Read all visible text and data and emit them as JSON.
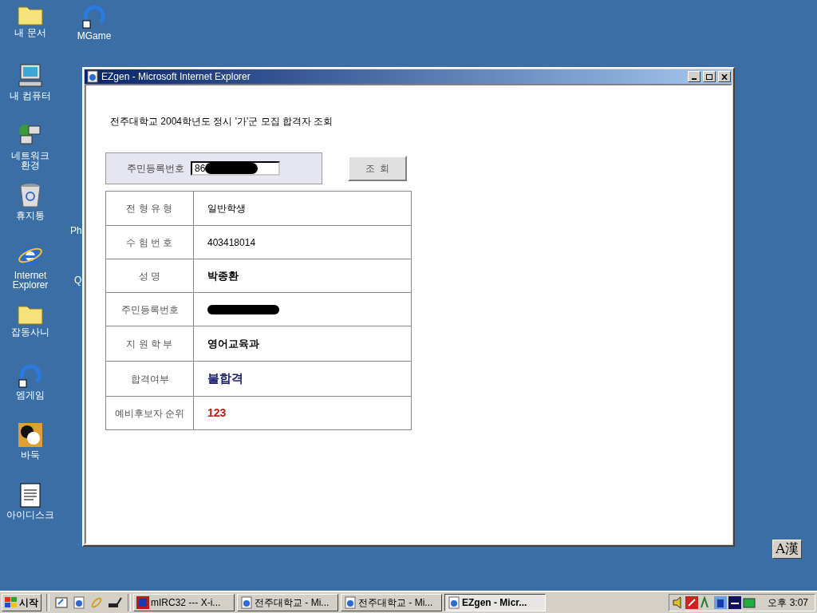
{
  "desktop_icons": [
    {
      "label": "내 문서",
      "kind": "folder-docs"
    },
    {
      "label": "내 컴퓨터",
      "kind": "computer"
    },
    {
      "label": "네트워크 환경",
      "kind": "network"
    },
    {
      "label": "휴지통",
      "kind": "bin"
    },
    {
      "label": "Internet Explorer",
      "kind": "ie"
    },
    {
      "label": "잡동사니",
      "kind": "folder"
    },
    {
      "label": "엠게임",
      "kind": "mgame"
    },
    {
      "label": "바둑",
      "kind": "go"
    },
    {
      "label": "아이디스크",
      "kind": "doc"
    }
  ],
  "desktop_icons_2": [
    {
      "label": "MGame",
      "kind": "mgame"
    },
    {
      "label": "Ph",
      "kind": "none"
    },
    {
      "label": "Q",
      "kind": "none"
    }
  ],
  "window": {
    "title": "EZgen - Microsoft Internet Explorer",
    "heading": "전주대학교 2004학년도 정시 '가'군 모집 합격자 조회",
    "search": {
      "label": "주민등록번호",
      "value": "86",
      "redacted": true
    },
    "button": "조  회",
    "rows": [
      {
        "label": "전 형 유 형",
        "value": "일반학생",
        "kind": "plain"
      },
      {
        "label": "수 험 번 호",
        "value": "403418014",
        "kind": "plain"
      },
      {
        "label": "성 명",
        "value": "박종환",
        "kind": "bold"
      },
      {
        "label": "주민등록번호",
        "value": "",
        "kind": "redacted"
      },
      {
        "label": "지 원 학 부",
        "value": "영어교육과",
        "kind": "bold"
      },
      {
        "label": "합격여부",
        "value": "불합격",
        "kind": "status"
      },
      {
        "label": "예비후보자 순위",
        "value": "123",
        "kind": "rank"
      }
    ]
  },
  "ime": {
    "label": "A漢"
  },
  "taskbar": {
    "start": "시작",
    "tasks": [
      {
        "label": "mIRC32 ---  X-i...",
        "kind": "irc",
        "selected": false
      },
      {
        "label": "전주대학교 - Mi...",
        "kind": "ie",
        "selected": false
      },
      {
        "label": "전주대학교 - Mi...",
        "kind": "ie",
        "selected": false
      },
      {
        "label": "EZgen - Micr...",
        "kind": "ie",
        "selected": true
      }
    ],
    "clock": "오후 3:07"
  }
}
